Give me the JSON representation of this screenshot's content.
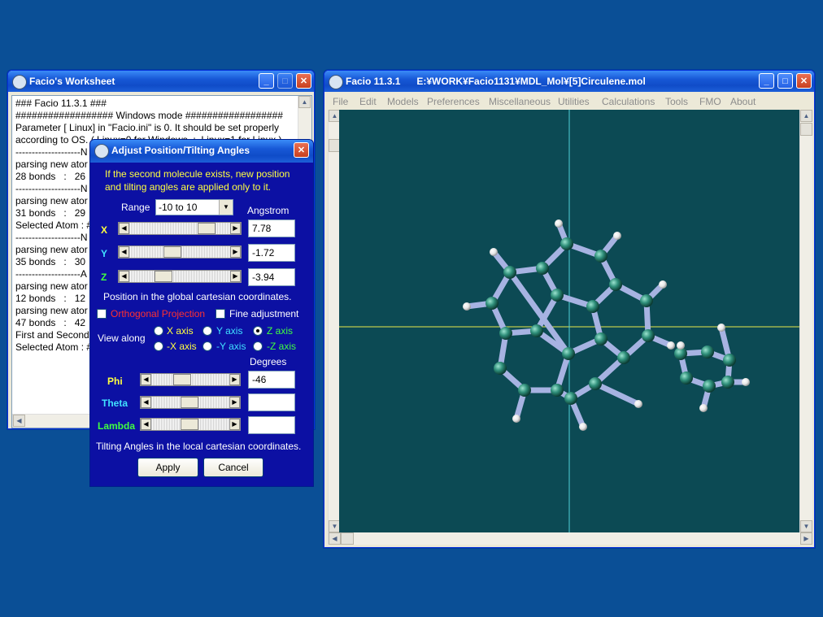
{
  "worksheet": {
    "title": "Facio's Worksheet",
    "lines": [
      "### Facio 11.3.1 ###",
      "################## Windows mode ##################",
      "Parameter [ Linux] in \"Facio.ini\" is 0. It should be set properly",
      "according to OS. ( Linux=0 for Windows  :  Linux=1 for Linux )",
      "--------------------N",
      "parsing new ator",
      "28 bonds   :   26",
      "--------------------N",
      "parsing new ator",
      "31 bonds   :   29",
      "Selected Atom : #",
      "--------------------N",
      "parsing new ator",
      "35 bonds   :   30",
      "--------------------A",
      "parsing new ator",
      "12 bonds   :   12",
      "parsing new ator",
      "47 bonds   :   42",
      "First and Second",
      "Selected Atom : #"
    ]
  },
  "main": {
    "title": "Facio 11.3.1      E:¥WORK¥Facio1131¥MDL_Mol¥[5]Circulene.mol",
    "menu": [
      "File",
      "Edit",
      "Models",
      "Preferences",
      "Miscellaneous",
      "Utilities",
      "Calculations",
      "Tools",
      "FMO",
      "About"
    ]
  },
  "dialog": {
    "title": "Adjust Position/Tilting Angles",
    "info_line1": "If the second molecule exists,  new position",
    "info_line2": "and tilting angles are applied only to it.",
    "range_label": "Range",
    "range_value": "-10 to 10",
    "angstrom_label": "Angstrom",
    "x_label": "X",
    "x_value": "7.78",
    "x_level": 0.82,
    "y_label": "Y",
    "y_value": "-1.72",
    "y_level": 0.41,
    "z_label": "Z",
    "z_value": "-3.94",
    "z_level": 0.3,
    "position_caption": "Position in the global cartesian coordinates.",
    "ortho_label": "Orthogonal Projection",
    "fine_label": "Fine adjustment",
    "view_along_label": "View along",
    "axes": [
      "X axis",
      "Y axis",
      "Z axis",
      "-X axis",
      "-Y axis",
      "-Z axis"
    ],
    "selected_axis": "Z axis",
    "degrees_label": "Degrees",
    "phi_label": "Phi",
    "phi_value": "-46",
    "phi_level": 0.37,
    "theta_label": "Theta",
    "theta_value": "",
    "theta_level": 0.48,
    "lambda_label": "Lambda",
    "lambda_value": "",
    "lambda_level": 0.48,
    "tilt_caption": "Tilting Angles in the local cartesian coordinates.",
    "apply_label": "Apply",
    "cancel_label": "Cancel"
  },
  "colors": {
    "desktop": "#0a4f96",
    "dialog_bg": "#0c10a3",
    "canvas_bg": "#0c4a54",
    "atom_carbon": "#2f8f7a",
    "atom_hydrogen": "#f0f0f0",
    "bond": "#a7b3e2",
    "axis_h": "#e8e84a",
    "axis_v": "#4fd0d8"
  }
}
